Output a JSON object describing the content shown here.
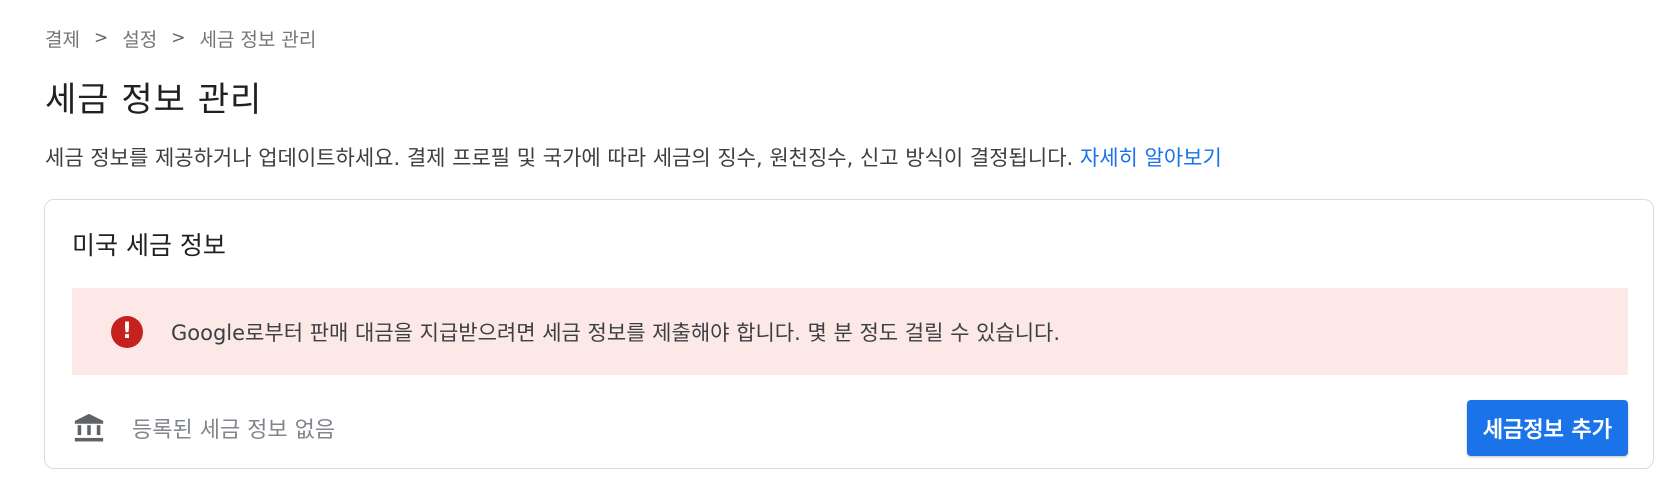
{
  "breadcrumb": {
    "items": [
      "결제",
      "설정",
      "세금 정보 관리"
    ],
    "separator": ">"
  },
  "page": {
    "title": "세금 정보 관리",
    "description": "세금 정보를 제공하거나 업데이트하세요. 결제 프로필 및 국가에 따라 세금의 징수, 원천징수, 신고 방식이 결정됩니다.",
    "learn_more_link": "자세히 알아보기"
  },
  "card": {
    "title": "미국 세금 정보",
    "alert": {
      "icon": "error-icon",
      "icon_glyph": "!",
      "text": "Google로부터 판매 대금을 지급받으려면 세금 정보를 제출해야 합니다. 몇 분 정도 걸릴 수 있습니다."
    },
    "empty_state": {
      "icon": "bank-icon",
      "text": "등록된 세금 정보 없음"
    },
    "add_button_label": "세금정보 추가"
  },
  "colors": {
    "accent": "#1a73e8",
    "alert_background": "#fce8e6",
    "alert_icon": "#c5221f"
  }
}
